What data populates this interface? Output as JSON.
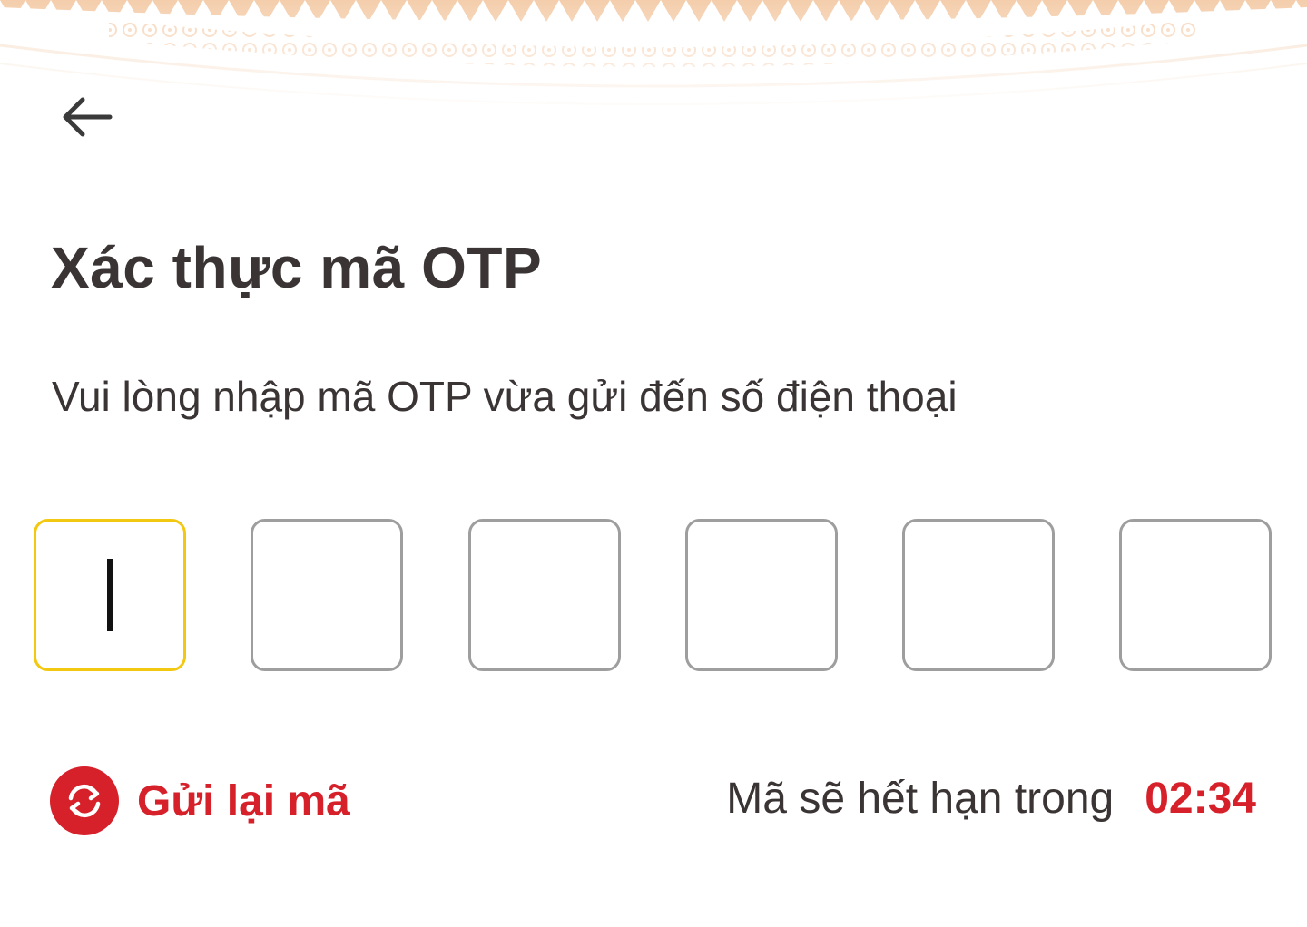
{
  "header": {
    "back_icon": "arrow-left-icon"
  },
  "main": {
    "title": "Xác thực mã OTP",
    "subtitle": "Vui lòng nhập mã OTP vừa gửi đến số điện thoại",
    "otp_fields": [
      "",
      "",
      "",
      "",
      "",
      ""
    ],
    "active_field_index": 0
  },
  "footer": {
    "resend_icon": "refresh-icon",
    "resend_label": "Gửi lại mã",
    "expire_label": "Mã sẽ hết hạn trong",
    "expire_time": "02:34"
  },
  "colors": {
    "accent_red": "#d6202a",
    "active_border": "#f2c811",
    "inactive_border": "#9e9e9e",
    "text": "#3a3434",
    "pattern": "#f3c9a3"
  }
}
